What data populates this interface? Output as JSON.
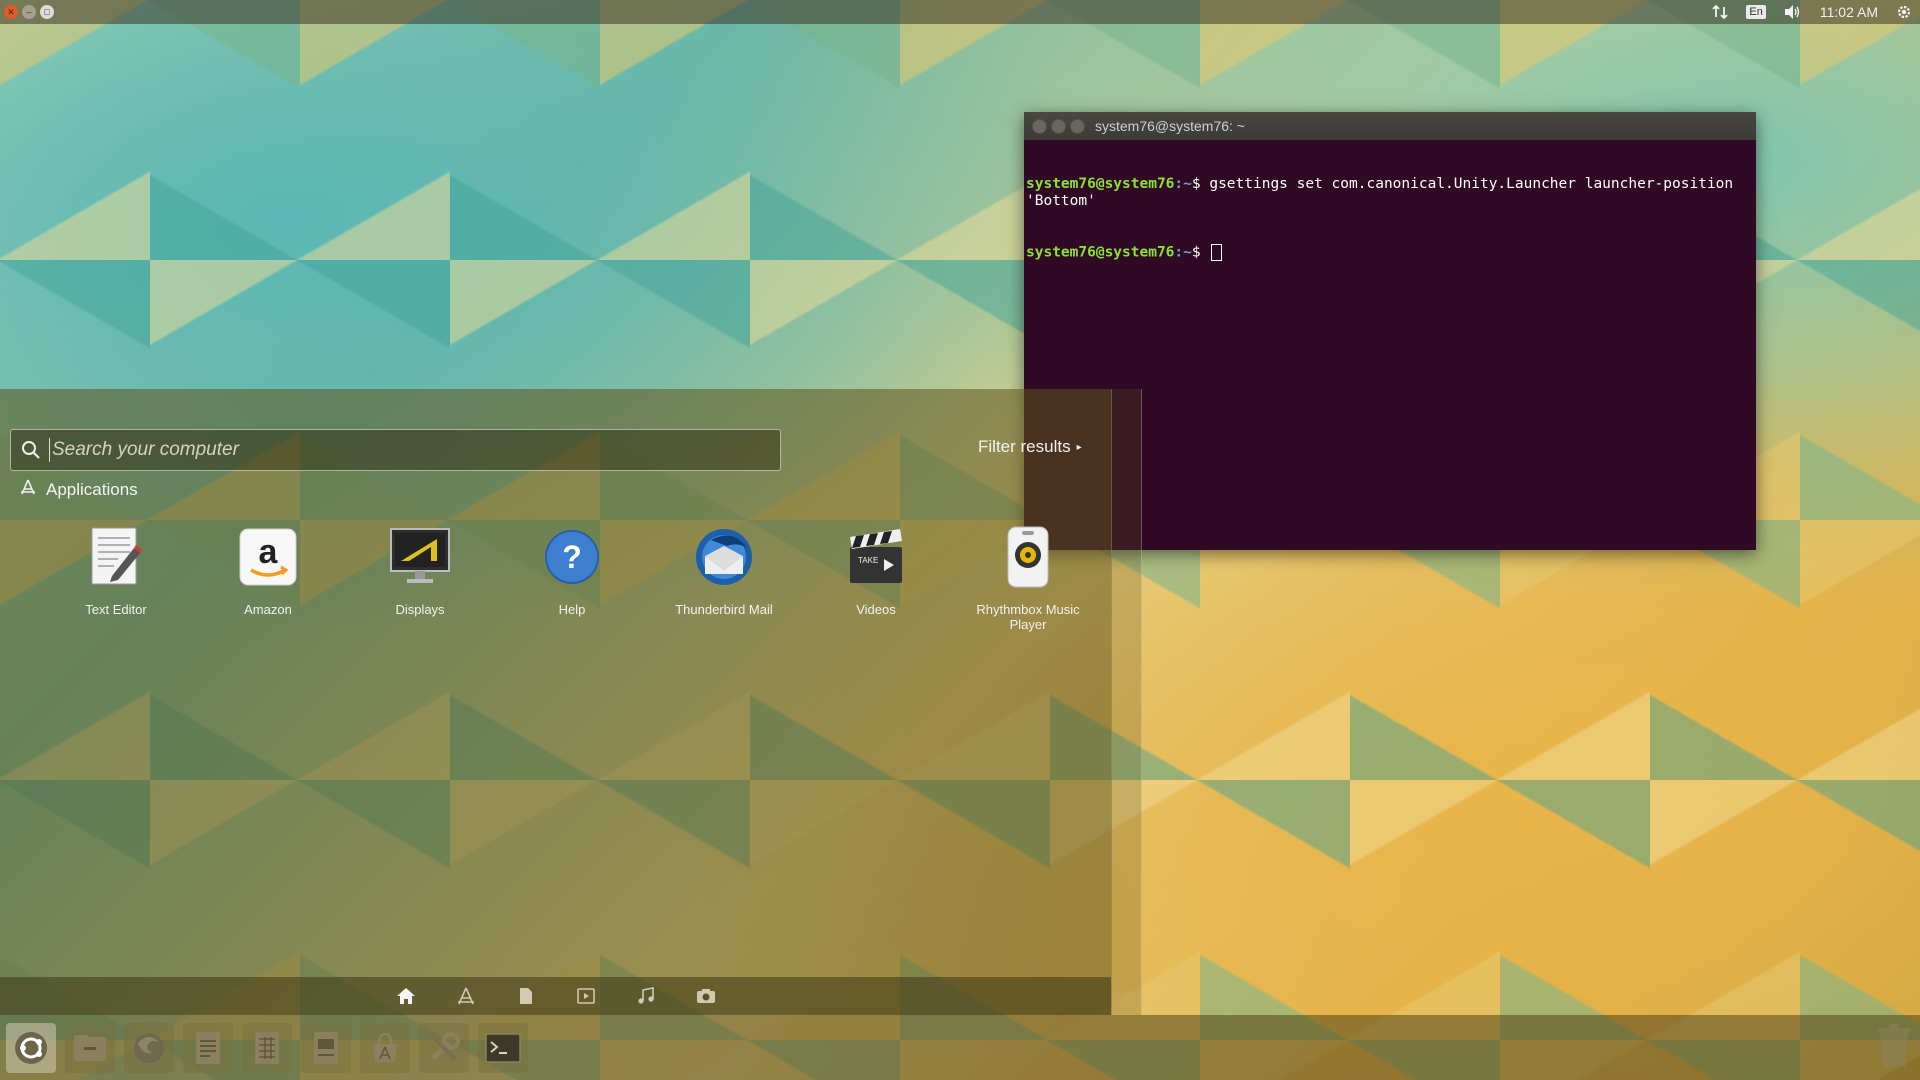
{
  "top_panel": {
    "clock": "11:02 AM",
    "keyboard_layout": "En"
  },
  "terminal": {
    "title": "system76@system76: ~",
    "lines": [
      {
        "user": "system76@system76",
        "path": ":~",
        "prompt": "$ ",
        "command": "gsettings set com.canonical.Unity.Launcher launcher-position 'Bottom'"
      },
      {
        "user": "system76@system76",
        "path": ":~",
        "prompt": "$ ",
        "command": ""
      }
    ]
  },
  "dash": {
    "search": {
      "placeholder": "Search your computer",
      "value": ""
    },
    "filter_label": "Filter results",
    "section_title": "Applications",
    "apps": [
      {
        "label": "Text Editor",
        "icon": "text-editor-icon"
      },
      {
        "label": "Amazon",
        "icon": "amazon-icon"
      },
      {
        "label": "Displays",
        "icon": "displays-icon"
      },
      {
        "label": "Help",
        "icon": "help-icon"
      },
      {
        "label": "Thunderbird Mail",
        "icon": "thunderbird-icon"
      },
      {
        "label": "Videos",
        "icon": "videos-icon"
      },
      {
        "label": "Rhythmbox Music Player",
        "icon": "rhythmbox-icon"
      }
    ],
    "lenses": [
      "home-icon",
      "applications-icon",
      "files-icon",
      "video-icon",
      "music-icon",
      "photos-icon"
    ]
  },
  "launcher": {
    "items": [
      "dash-home-icon",
      "files-icon",
      "firefox-icon",
      "writer-icon",
      "calc-icon",
      "impress-icon",
      "software-center-icon",
      "system-settings-icon",
      "terminal-icon"
    ],
    "trash": "trash-icon"
  },
  "colors": {
    "terminal_bg": "#300a24",
    "prompt_user": "#8ae234",
    "prompt_path": "#729fcf",
    "close_button": "#e05a2a"
  }
}
